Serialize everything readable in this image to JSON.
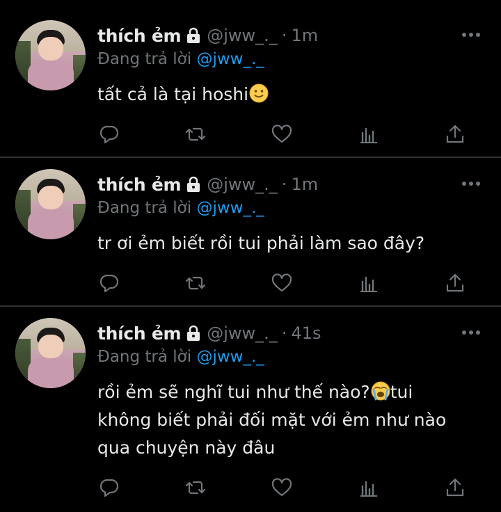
{
  "tweets": [
    {
      "name": "thích ẻm",
      "handle": "@jww_._",
      "separator": "·",
      "time": "1m",
      "reply_prefix": "Đang trả lời",
      "reply_mention": "@jww_._",
      "text_lines": [
        "tất cả là tại hoshi"
      ],
      "emoji": "slightly-smiling-face"
    },
    {
      "name": "thích ẻm",
      "handle": "@jww_._",
      "separator": "·",
      "time": "1m",
      "reply_prefix": "Đang trả lời",
      "reply_mention": "@jww_._",
      "text_lines": [
        "tr ơi ẻm biết rồi tui phải làm sao đây?"
      ],
      "emoji": ""
    },
    {
      "name": "thích ẻm",
      "handle": "@jww_._",
      "separator": "·",
      "time": "41s",
      "reply_prefix": "Đang trả lời",
      "reply_mention": "@jww_._",
      "text_lines": [
        "rồi ẻm sẽ nghĩ tui như thế nào?",
        "tui",
        "không biết phải đối mặt với ẻm như nào",
        "qua chuyện này đâu"
      ],
      "emoji": "loudly-crying-face"
    }
  ],
  "actions": [
    "reply-icon",
    "retweet-icon",
    "like-icon",
    "views-icon",
    "share-icon"
  ],
  "colors": {
    "background": "#000000",
    "text": "#e7e9ea",
    "secondary": "#71767b",
    "link": "#1d9bf0",
    "divider": "#2f3336"
  }
}
